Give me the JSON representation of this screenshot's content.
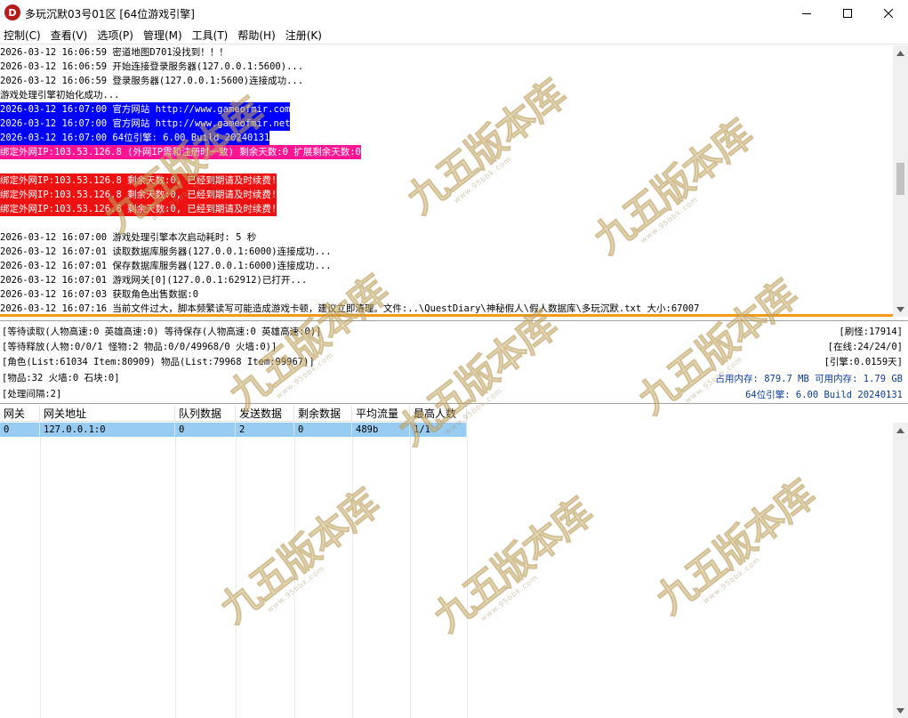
{
  "window": {
    "icon_letter": "D",
    "title": "多玩沉默03号01区 [64位游戏引擎]"
  },
  "menu": [
    {
      "label": "控制(C)"
    },
    {
      "label": "查看(V)"
    },
    {
      "label": "选项(P)"
    },
    {
      "label": "管理(M)"
    },
    {
      "label": "工具(T)"
    },
    {
      "label": "帮助(H)"
    },
    {
      "label": "注册(K)"
    }
  ],
  "log": [
    {
      "text": "2026-03-12 16:06:59 密道地图D701没找到！！！",
      "style": ""
    },
    {
      "text": "2026-03-12 16:06:59 开始连接登录服务器(127.0.0.1:5600)...",
      "style": ""
    },
    {
      "text": "2026-03-12 16:06:59 登录服务器(127.0.0.1:5600)连接成功...",
      "style": ""
    },
    {
      "text": "游戏处理引擎初始化成功...",
      "style": ""
    },
    {
      "text": "2026-03-12 16:07:00 官方网站 http://www.gameofmir.com",
      "style": "blue"
    },
    {
      "text": "2026-03-12 16:07:00 官方网站 http://www.gameofmir.net",
      "style": "blue"
    },
    {
      "text": "2026-03-12 16:07:00 64位引擎: 6.00 Build 20240131",
      "style": "blue"
    },
    {
      "text": "绑定外网IP:103.53.126.8 (外网IP需和注册时一致) 剩余天数:0 扩展剩余天数:0",
      "style": "pink"
    },
    {
      "text": "",
      "style": ""
    },
    {
      "text": "绑定外网IP:103.53.126.8 剩余天数:0, 已经到期请及时续费!",
      "style": "red"
    },
    {
      "text": "绑定外网IP:103.53.126.8 剩余天数:0, 已经到期请及时续费!",
      "style": "red"
    },
    {
      "text": "绑定外网IP:103.53.126.8 剩余天数:0, 已经到期请及时续费!",
      "style": "red"
    },
    {
      "text": "",
      "style": ""
    },
    {
      "text": "2026-03-12 16:07:00 游戏处理引擎本次启动耗时: 5 秒",
      "style": ""
    },
    {
      "text": "2026-03-12 16:07:01 读取数据库服务器(127.0.0.1:6000)连接成功...",
      "style": ""
    },
    {
      "text": "2026-03-12 16:07:01 保存数据库服务器(127.0.0.1:6000)连接成功...",
      "style": ""
    },
    {
      "text": "2026-03-12 16:07:01 游戏网关[0](127.0.0.1:62912)已打开...",
      "style": ""
    },
    {
      "text": "2026-03-12 16:07:03 获取角色出售数据:0",
      "style": ""
    },
    {
      "text": "2026-03-12 16:07:16 当前文件过大，脚本频繁读写可能造成游戏卡顿，建议立即清理。文件:..\\QuestDiary\\神秘假人\\假人数据库\\多玩沉默.txt 大小:67007",
      "style": ""
    }
  ],
  "status": {
    "line1": "[等待读取(人物高速:0 英雄高速:0) 等待保存(人物高速:0 英雄高速:0)]",
    "line2": "[等待释放(人物:0/0/1 怪物:2 物品:0/0/49968/0 火墙:0)]",
    "line3": "[角色(List:61034 Item:80909) 物品(List:79968 Item:99967)]",
    "line4": "[物品:32 火墙:0 石块:0]",
    "line5": "[处理间隔:2]",
    "right1": "[刷怪:17914]",
    "right2": "[在线:24/24/0]",
    "right3": "[引擎:0.0159天]",
    "right4": "占用内存: 879.7 MB 可用内存: 1.79 GB",
    "right5": "64位引擎: 6.00 Build 20240131"
  },
  "gateway_table": {
    "columns": [
      "网关",
      "网关地址",
      "队列数据",
      "发送数据",
      "剩余数据",
      "平均流量",
      "最高人数"
    ],
    "rows": [
      [
        "0",
        "127.0.0.1:0",
        "0",
        "2",
        "0",
        "489b",
        "1/1"
      ]
    ]
  },
  "watermark": {
    "text": "九五版本库",
    "sub": "www.95bbk.com"
  },
  "colors": {
    "log_blue": "#0000ff",
    "log_pink": "#ff1493",
    "log_red": "#ee1111",
    "selected_row": "#99ccf3",
    "orange_bar": "#f59a16"
  }
}
